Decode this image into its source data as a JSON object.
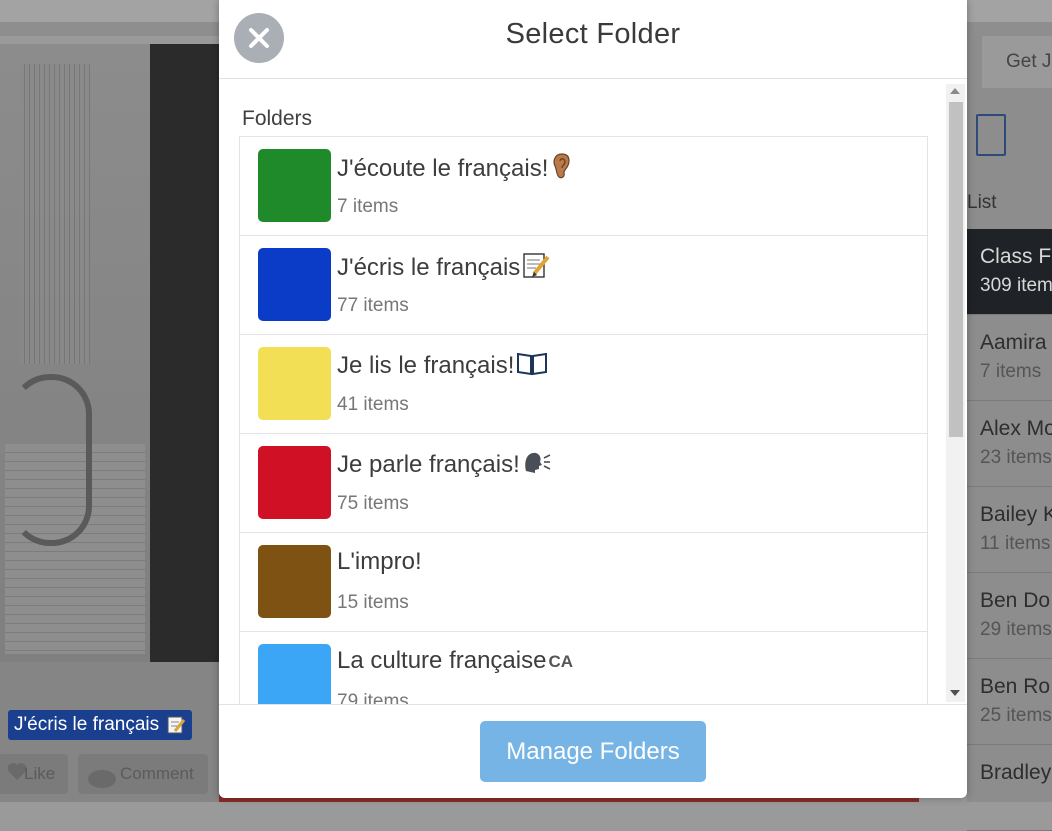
{
  "modal": {
    "title": "Select Folder",
    "section_label": "Folders",
    "manage_button": "Manage Folders"
  },
  "folders": [
    {
      "name": "J'écoute le français!",
      "emoji": "ear-icon",
      "count": "7 items",
      "color": "#1e8a2a"
    },
    {
      "name": "J'écris le français",
      "emoji": "memo-icon",
      "count": "77 items",
      "color": "#0a3cc7"
    },
    {
      "name": "Je lis le français!",
      "emoji": "book-icon",
      "count": "41 items",
      "color": "#f2df55"
    },
    {
      "name": "Je parle français!",
      "emoji": "speaking-head-icon",
      "count": "75 items",
      "color": "#d01025"
    },
    {
      "name": "L'impro!",
      "emoji": "",
      "count": "15 items",
      "color": "#7d5213"
    },
    {
      "name": "La culture française",
      "emoji": "",
      "suffix": "CA",
      "count": "79 items",
      "color": "#3aa6f5"
    }
  ],
  "background": {
    "post_tag": "J'écris le français",
    "like_label": "Like",
    "comment_label": "Comment",
    "right_button": "Get Je",
    "list_label": "List",
    "roster": [
      {
        "name": "Class F",
        "count": "309 item",
        "active": true
      },
      {
        "name": "Aamira",
        "count": "7 items"
      },
      {
        "name": "Alex Mo",
        "count": "23 items"
      },
      {
        "name": "Bailey K",
        "count": "11 items"
      },
      {
        "name": "Ben Do",
        "count": "29 items"
      },
      {
        "name": "Ben Ro",
        "count": "25 items"
      },
      {
        "name": "Bradley",
        "count": ""
      }
    ]
  }
}
